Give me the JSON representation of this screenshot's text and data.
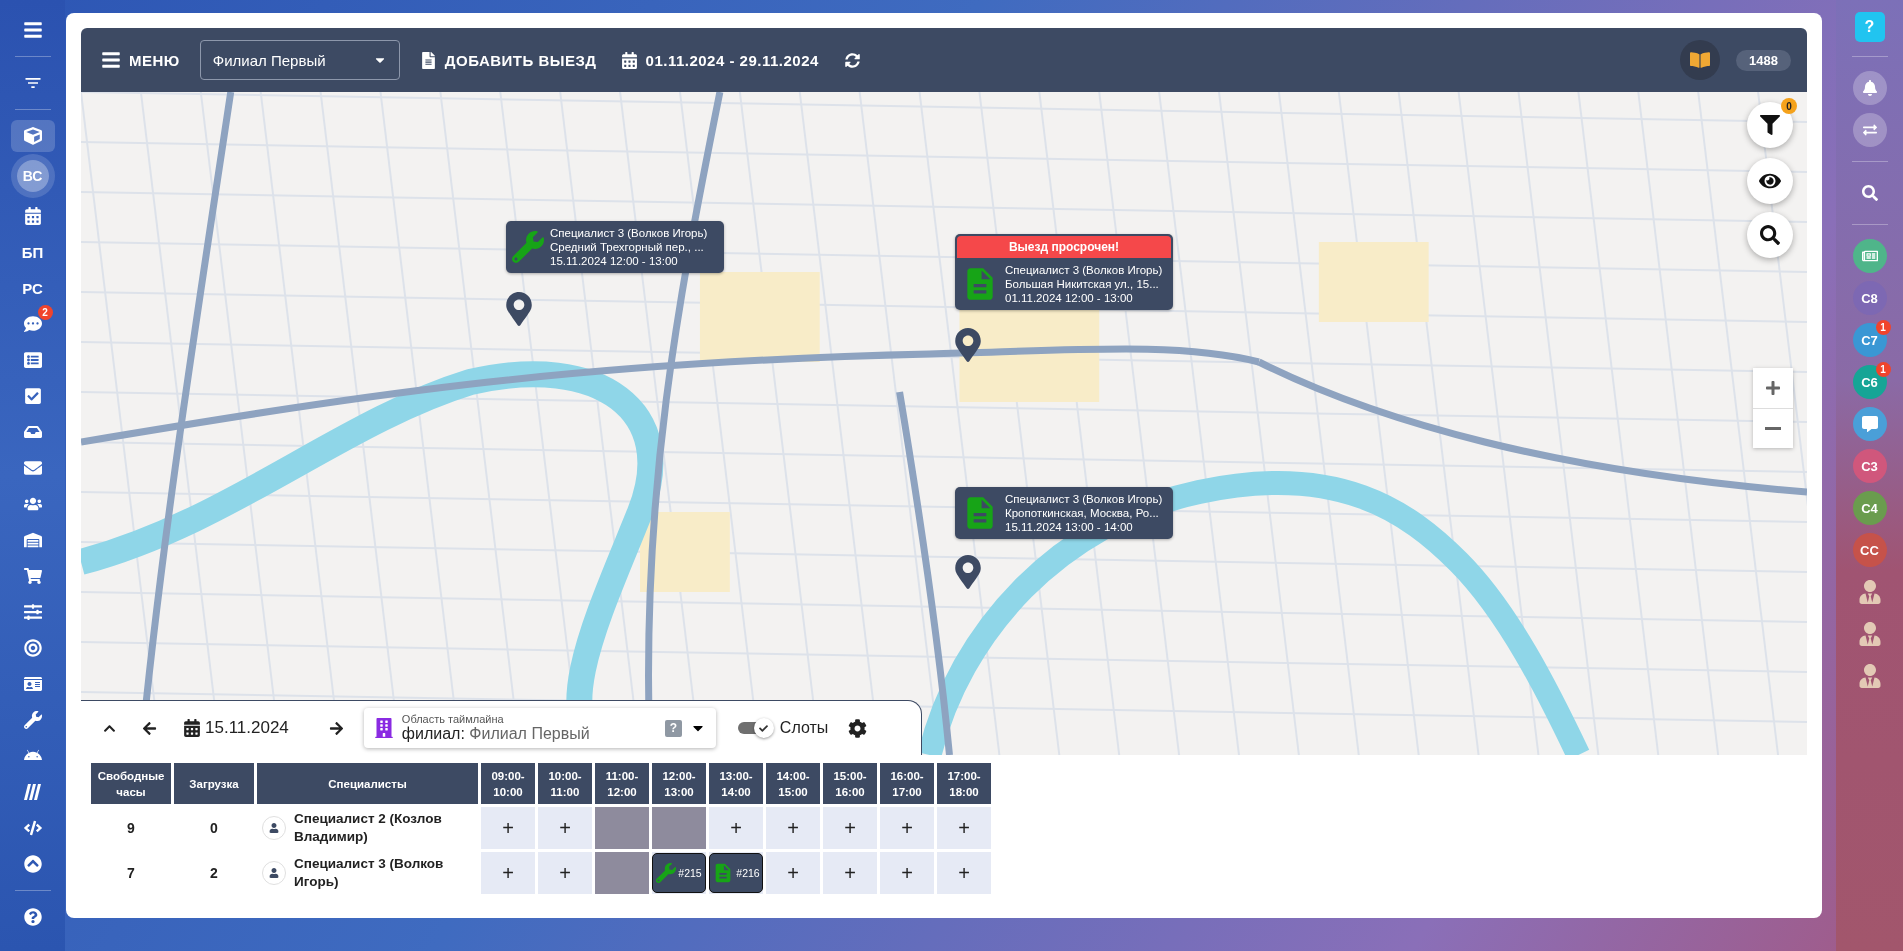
{
  "left_sidebar": [
    {
      "kind": "icon",
      "selected": false
    },
    {
      "kind": "icon",
      "selected": false
    },
    {
      "kind": "icon",
      "selected": true
    },
    {
      "kind": "avatar",
      "label": "ВС",
      "selected": true
    },
    {
      "kind": "icon",
      "selected": false
    },
    {
      "kind": "text",
      "label": "БП",
      "selected": false
    },
    {
      "kind": "text",
      "label": "РС",
      "selected": false
    },
    {
      "kind": "icon",
      "selected": false,
      "badge": "2"
    },
    {
      "kind": "icon",
      "selected": false
    },
    {
      "kind": "icon",
      "selected": false
    },
    {
      "kind": "icon",
      "selected": false
    },
    {
      "kind": "icon",
      "selected": false
    },
    {
      "kind": "icon",
      "selected": false
    },
    {
      "kind": "icon",
      "selected": false
    },
    {
      "kind": "icon",
      "selected": false
    },
    {
      "kind": "icon",
      "selected": false
    },
    {
      "kind": "icon",
      "selected": false
    },
    {
      "kind": "icon",
      "selected": false
    },
    {
      "kind": "icon",
      "selected": false
    },
    {
      "kind": "icon",
      "selected": false
    },
    {
      "kind": "icon",
      "selected": false
    },
    {
      "kind": "icon",
      "selected": false
    },
    {
      "kind": "icon",
      "selected": false
    },
    {
      "kind": "icon",
      "selected": false
    }
  ],
  "toolbar": {
    "menu_label": "МЕНЮ",
    "branch_select": "Филиал Первый",
    "add_visit": "ДОБАВИТЬ ВЫЕЗД",
    "date_range": "01.11.2024 - 29.11.2024",
    "counter": "1488"
  },
  "map": {
    "filter_badge": "0",
    "visits": [
      {
        "kind": "repair",
        "specialist": "Специалист 3 (Волков Игорь)",
        "address": "Средний Трехгорный пер., ...",
        "time": "15.11.2024 12:00 - 13:00"
      },
      {
        "kind": "document",
        "alert": "Выезд просрочен!",
        "specialist": "Специалист 3 (Волков Игорь)",
        "address": "Большая Никитская ул., 15...",
        "time": "01.11.2024 12:00 - 13:00"
      },
      {
        "kind": "document",
        "specialist": "Специалист 3 (Волков Игорь)",
        "address": "Кропоткинская, Москва, Ро...",
        "time": "15.11.2024 13:00 - 14:00"
      }
    ]
  },
  "timeline": {
    "date": "15.11.2024",
    "scope_label": "Область таймлайна",
    "scope_prefix": "филиал:",
    "scope_value": "Филиал Первый",
    "help": "?",
    "slots_label": "Слоты",
    "slots_on": true
  },
  "table": {
    "columns": [
      "Свободные часы",
      "Загрузка",
      "Специалисты",
      "09:00-10:00",
      "10:00-11:00",
      "11:00-12:00",
      "12:00-13:00",
      "13:00-14:00",
      "14:00-15:00",
      "15:00-16:00",
      "16:00-17:00",
      "17:00-18:00"
    ],
    "rows": [
      {
        "free_hours": "9",
        "load": "0",
        "specialist": "Специалист 2 (Козлов Владимир)",
        "slots": [
          {
            "kind": "free",
            "label": "+"
          },
          {
            "kind": "free",
            "label": "+"
          },
          {
            "kind": "blocked"
          },
          {
            "kind": "blocked"
          },
          {
            "kind": "free",
            "label": "+"
          },
          {
            "kind": "free",
            "label": "+"
          },
          {
            "kind": "free",
            "label": "+"
          },
          {
            "kind": "free",
            "label": "+"
          },
          {
            "kind": "free",
            "label": "+"
          }
        ]
      },
      {
        "free_hours": "7",
        "load": "2",
        "specialist": "Специалист 3 (Волков Игорь)",
        "slots": [
          {
            "kind": "free",
            "label": "+"
          },
          {
            "kind": "free",
            "label": "+"
          },
          {
            "kind": "blocked"
          },
          {
            "kind": "repair",
            "label": "#215"
          },
          {
            "kind": "document",
            "label": "#216"
          },
          {
            "kind": "free",
            "label": "+"
          },
          {
            "kind": "free",
            "label": "+"
          },
          {
            "kind": "free",
            "label": "+"
          },
          {
            "kind": "free",
            "label": "+"
          }
        ]
      }
    ]
  },
  "right_sidebar": [
    {
      "kind": "help",
      "label": "?"
    },
    {
      "kind": "icon"
    },
    {
      "kind": "icon"
    },
    {
      "kind": "search"
    },
    {
      "kind": "picture",
      "color": "#4fb58a"
    },
    {
      "kind": "initials",
      "label": "С8",
      "color": "#7d68b3"
    },
    {
      "kind": "initials",
      "label": "С7",
      "color": "#3a97d4",
      "badge": "1"
    },
    {
      "kind": "initials",
      "label": "С6",
      "color": "#16a596",
      "badge": "1"
    },
    {
      "kind": "picture",
      "color": "#4a9fd8"
    },
    {
      "kind": "initials",
      "label": "С3",
      "color": "#d0577c"
    },
    {
      "kind": "initials",
      "label": "С4",
      "color": "#6a9c4e"
    },
    {
      "kind": "initials",
      "label": "СС",
      "color": "#c6524a"
    },
    {
      "kind": "person"
    },
    {
      "kind": "person"
    },
    {
      "kind": "person"
    }
  ]
}
